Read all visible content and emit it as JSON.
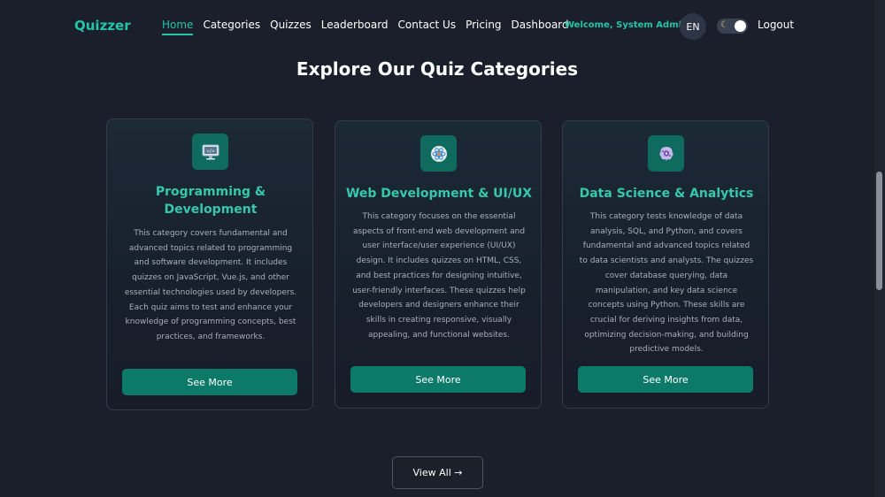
{
  "brand": {
    "name": "Quizzer",
    "color": "#22c5a8"
  },
  "nav": {
    "links": [
      "Home",
      "Categories",
      "Quizzes",
      "Leaderboard",
      "Contact Us",
      "Pricing",
      "Dashboard"
    ],
    "active": "Home"
  },
  "user": {
    "welcome": "Welcome, System Admin!",
    "lang": "EN",
    "theme_toggle_icon": "moon-icon",
    "logout": "Logout"
  },
  "page": {
    "title": "Explore Our Quiz Categories"
  },
  "categories": [
    {
      "icon": "monitor-code-icon",
      "title": "Programming & Development",
      "description": "This category covers fundamental and advanced topics related to programming and software development. It includes quizzes on JavaScript, Vue.js, and other essential technologies used by developers. Each quiz aims to test and enhance your knowledge of programming concepts, best practices, and frameworks.",
      "button": "See More"
    },
    {
      "icon": "atom-icon",
      "title": "Web Development & UI/UX",
      "description": "This category focuses on the essential aspects of front-end web development and user interface/user experience (UI/UX) design. It includes quizzes on HTML, CSS, and best practices for designing intuitive, user-friendly interfaces. These quizzes help developers and designers enhance their skills in creating responsive, visually appealing, and functional websites.",
      "button": "See More"
    },
    {
      "icon": "brain-gear-icon",
      "title": "Data Science & Analytics",
      "description": "This category tests knowledge of data analysis, SQL, and Python, and covers fundamental and advanced topics related to data scientists and analysts. The quizzes cover database querying, data manipulation, and key data science concepts using Python. These skills are crucial for deriving insights from data, optimizing decision-making, and building predictive models.",
      "button": "See More"
    }
  ],
  "view_all": "View All →",
  "colors": {
    "background": "#1a1f2b",
    "accent": "#22c5a8",
    "button": "#0d7a69"
  }
}
